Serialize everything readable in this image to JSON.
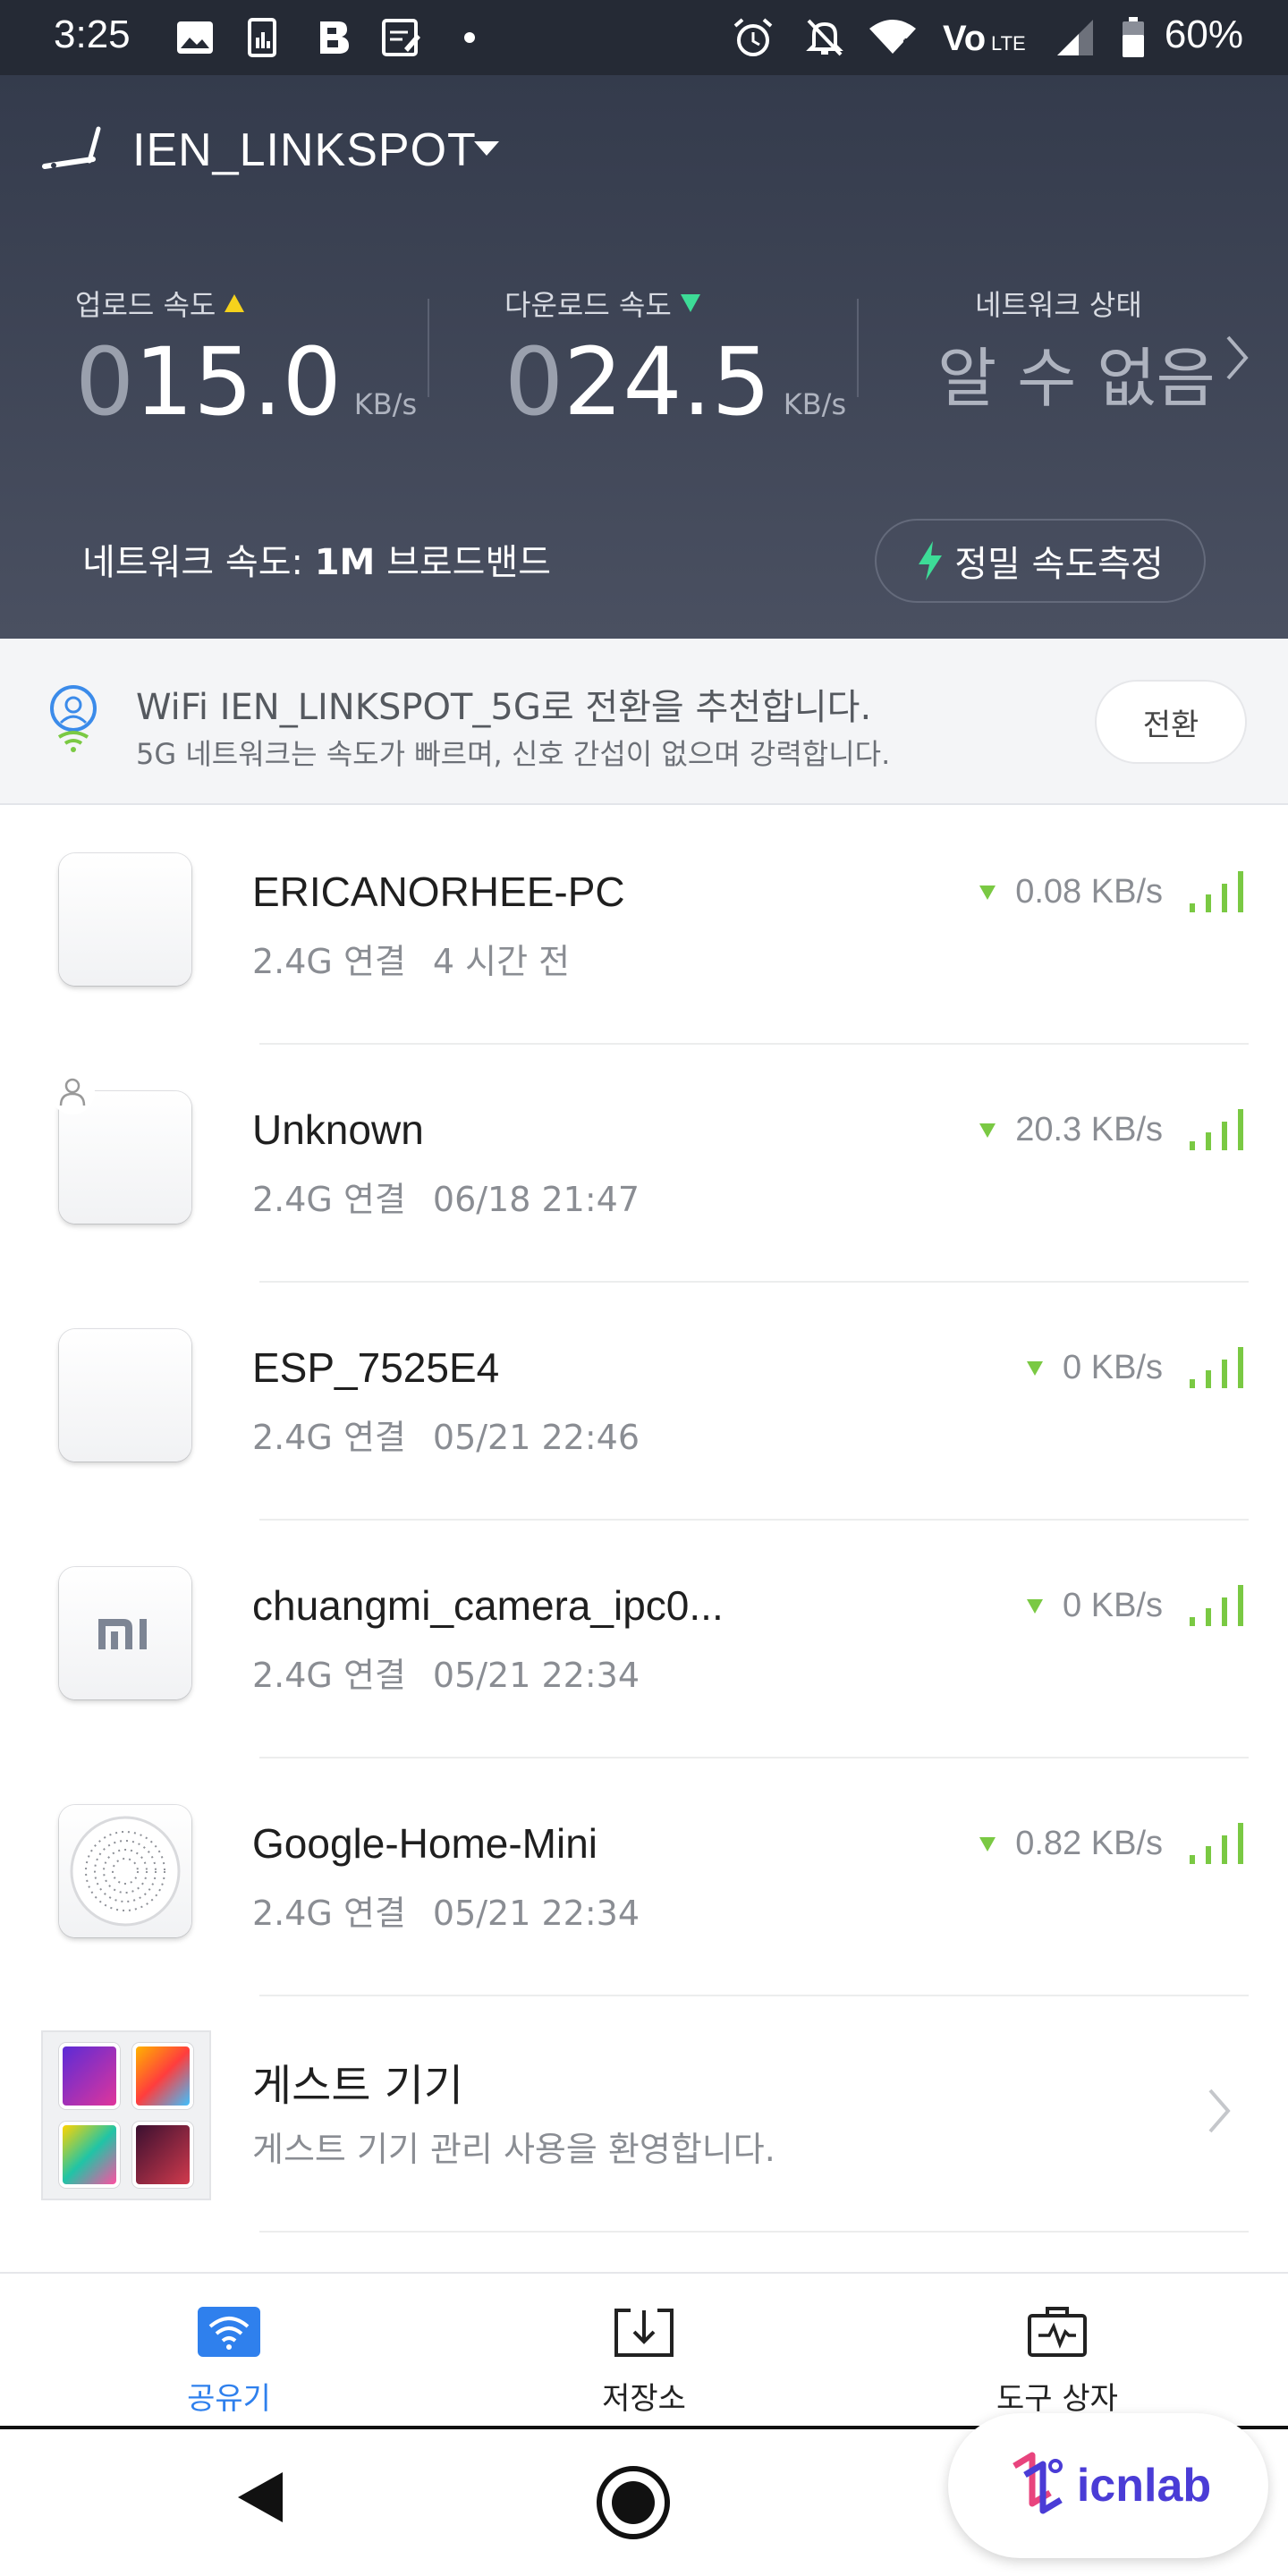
{
  "status_bar": {
    "time": "3:25",
    "battery": "60%",
    "icons": [
      "gallery-icon",
      "sim-icon",
      "b-app-icon",
      "memo-icon",
      "dot-icon",
      "alarm-icon",
      "mute-icon",
      "wifi-icon",
      "volte-icon",
      "cell-signal-icon",
      "battery-icon"
    ]
  },
  "header": {
    "ssid": "IEN_LINKSPOT",
    "upload": {
      "label": "업로드 속도",
      "lead": "0",
      "value": "15.0",
      "unit": "KB/s"
    },
    "download": {
      "label": "다운로드 속도",
      "lead": "0",
      "value": "24.5",
      "unit": "KB/s"
    },
    "network_state": {
      "label": "네트워크 상태",
      "value": "알 수 없음"
    },
    "network_speed_prefix": "네트워크 속도: ",
    "network_speed_value": "1M",
    "network_speed_suffix": " 브로드밴드",
    "precise_test_label": "정밀 속도측정"
  },
  "banner": {
    "title": "WiFi IEN_LINKSPOT_5G로 전환을 추천합니다.",
    "subtitle": "5G 네트워크는 속도가 빠르며, 신호 간섭이 없으며 강력합니다.",
    "button": "전환"
  },
  "devices": [
    {
      "name": "ERICANORHEE-PC",
      "band": "2.4G 연결",
      "time": "4 시간 전",
      "speed": "0.08 KB/s"
    },
    {
      "name": "Unknown",
      "band": "2.4G 연결",
      "time": "06/18 21:47",
      "speed": "20.3 KB/s"
    },
    {
      "name": "ESP_7525E4",
      "band": "2.4G 연결",
      "time": "05/21 22:46",
      "speed": "0 KB/s"
    },
    {
      "name": "chuangmi_camera_ipc0...",
      "band": "2.4G 연결",
      "time": "05/21 22:34",
      "speed": "0 KB/s",
      "logo": "mi"
    },
    {
      "name": "Google-Home-Mini",
      "band": "2.4G 연결",
      "time": "05/21 22:34",
      "speed": "0.82 KB/s"
    }
  ],
  "guest": {
    "title": "게스트 기기",
    "subtitle": "게스트 기기 관리 사용을 환영합니다."
  },
  "tabs": [
    {
      "label": "공유기",
      "icon": "router-wifi-icon",
      "active": true
    },
    {
      "label": "저장소",
      "icon": "storage-download-icon",
      "active": false
    },
    {
      "label": "도구 상자",
      "icon": "toolbox-icon",
      "active": false
    }
  ],
  "watermark": "icnlab",
  "colors": {
    "header_bg": "#343b4c",
    "accent_blue": "#2f80ed",
    "signal_green": "#7ac943",
    "upload_arrow": "#f5d21c",
    "download_arrow": "#3ddc97"
  }
}
